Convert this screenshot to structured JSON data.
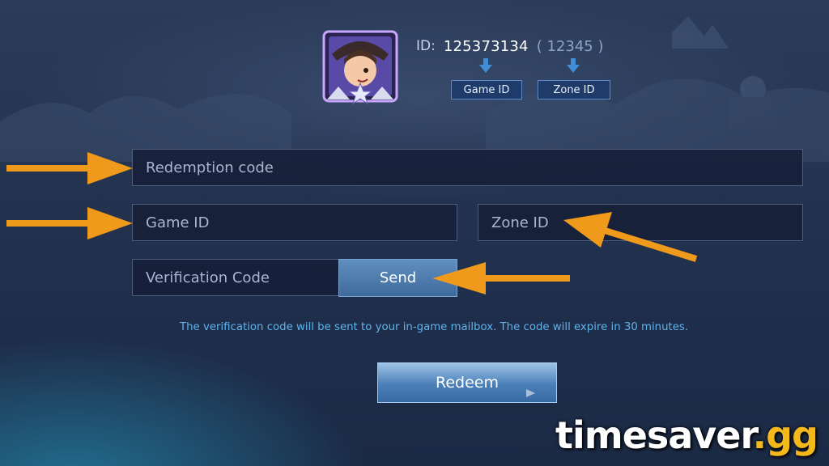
{
  "profile": {
    "id_label": "ID:",
    "game_id_value": "125373134",
    "zone_id_value": "( 12345 )",
    "game_id_tag": "Game ID",
    "zone_id_tag": "Zone ID",
    "avatar": "hero-avatar-icon"
  },
  "form": {
    "redemption_code_placeholder": "Redemption code",
    "game_id_placeholder": "Game ID",
    "zone_id_placeholder": "Zone ID",
    "verification_code_placeholder": "Verification Code",
    "send_label": "Send",
    "note": "The verification code will be sent to your in-game mailbox. The code will expire in 30 minutes.",
    "redeem_label": "Redeem"
  },
  "annotations": {
    "arrow_color": "#f09a1c"
  },
  "watermark": {
    "main": "timesaver",
    "tld": ".gg"
  },
  "colors": {
    "accent": "#5fb2ea",
    "button": "#4a7fb8",
    "brand_tld": "#f2b81c"
  }
}
